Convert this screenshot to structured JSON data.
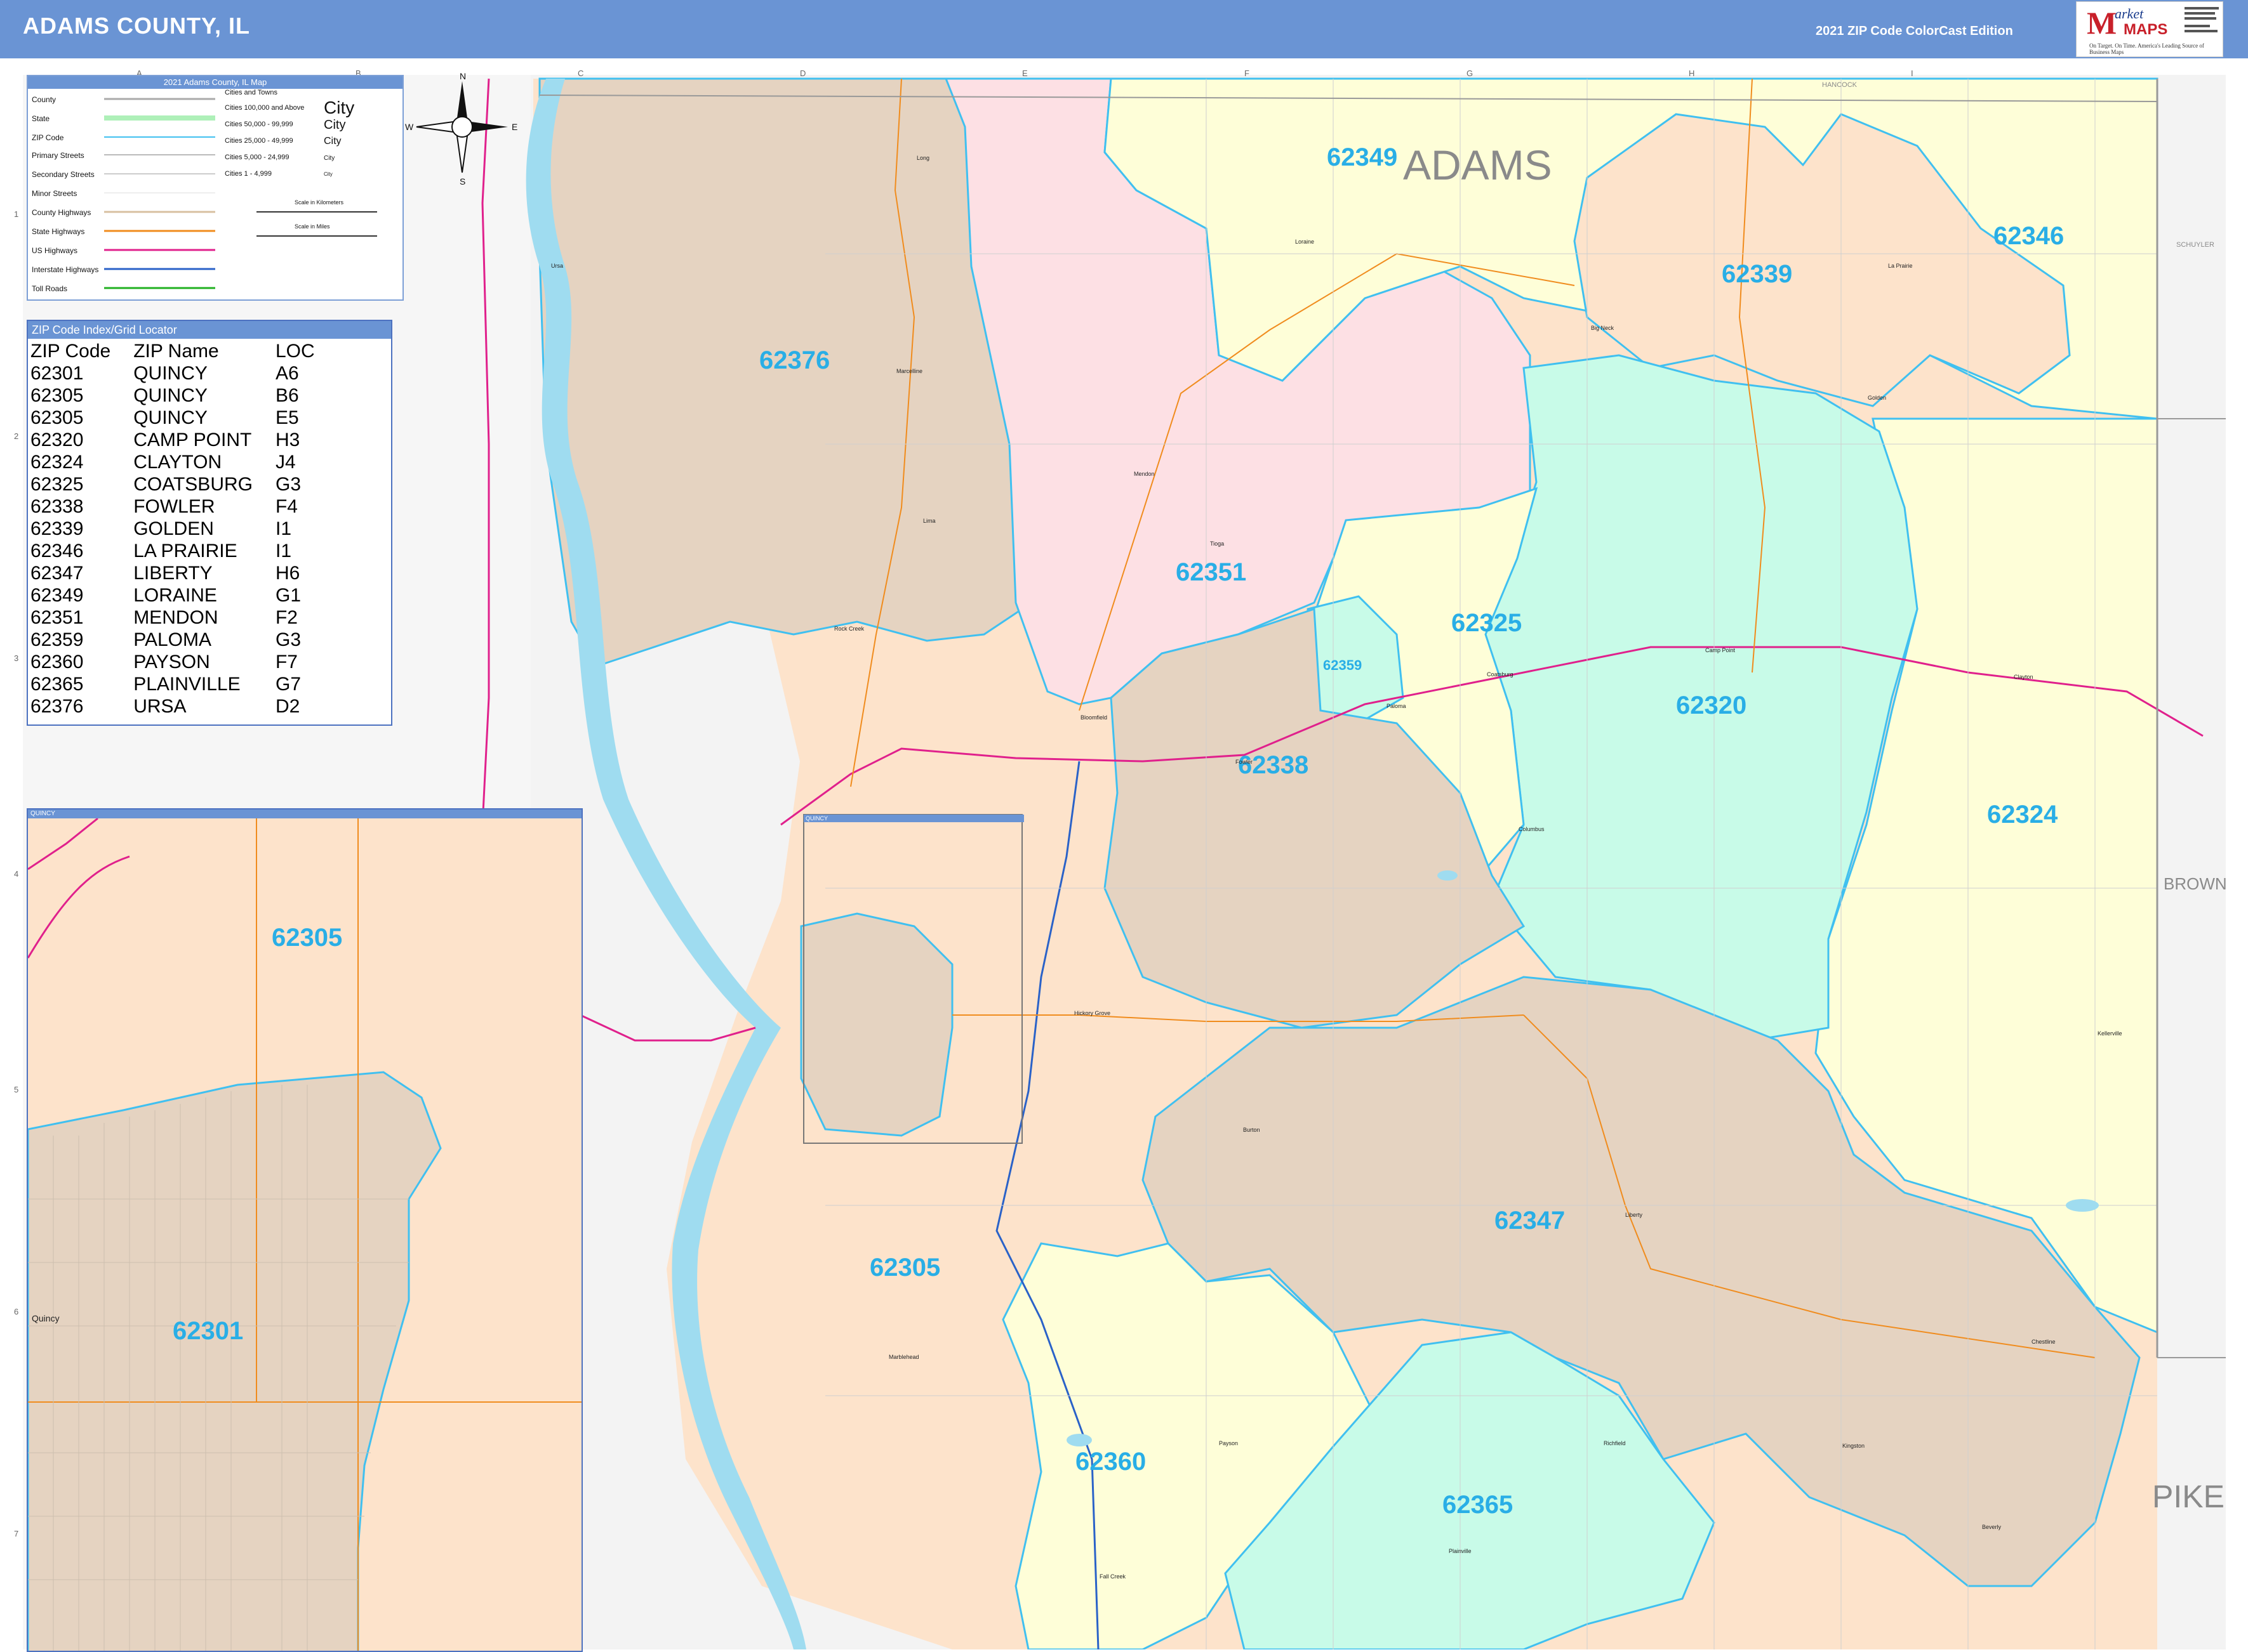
{
  "header": {
    "title": "ADAMS COUNTY, IL",
    "edition": "2021 ZIP Code ColorCast Edition",
    "logo_m": "M",
    "logo_text": "arket",
    "logo_maps": "MAPS",
    "logo_tagline": "On Target. On Time. America's Leading Source of Business Maps"
  },
  "grid": {
    "columns": [
      "A",
      "B",
      "C",
      "D",
      "E",
      "F",
      "G",
      "H",
      "I"
    ],
    "rows": [
      "1",
      "2",
      "3",
      "4",
      "5",
      "6",
      "7"
    ]
  },
  "legend": {
    "title": "2021 Adams County, IL Map",
    "items": [
      "County",
      "State",
      "ZIP Code",
      "Primary Streets",
      "Secondary Streets",
      "Minor Streets",
      "County Highways",
      "State Highways",
      "US Highways",
      "Interstate Highways",
      "Toll Roads"
    ],
    "cities_title": "Cities and Towns",
    "city_classes": [
      "Cities 100,000 and Above",
      "Cities 50,000 - 99,999",
      "Cities 25,000 - 49,999",
      "Cities 5,000 - 24,999",
      "Cities 1 - 4,999"
    ],
    "city_samples": [
      "City",
      "City",
      "City",
      "City",
      "City"
    ],
    "scale_km": "Scale in Kilometers",
    "scale_mi": "Scale in Miles"
  },
  "zip_index": {
    "title": "ZIP Code Index/Grid Locator",
    "headers": [
      "ZIP Code",
      "ZIP Name",
      "LOC"
    ],
    "rows": [
      [
        "62301",
        "QUINCY",
        "A6"
      ],
      [
        "62305",
        "QUINCY",
        "B6"
      ],
      [
        "62305",
        "QUINCY",
        "E5"
      ],
      [
        "62320",
        "CAMP POINT",
        "H3"
      ],
      [
        "62324",
        "CLAYTON",
        "J4"
      ],
      [
        "62325",
        "COATSBURG",
        "G3"
      ],
      [
        "62338",
        "FOWLER",
        "F4"
      ],
      [
        "62339",
        "GOLDEN",
        "I1"
      ],
      [
        "62346",
        "LA PRAIRIE",
        "I1"
      ],
      [
        "62347",
        "LIBERTY",
        "H6"
      ],
      [
        "62349",
        "LORAINE",
        "G1"
      ],
      [
        "62351",
        "MENDON",
        "F2"
      ],
      [
        "62359",
        "PALOMA",
        "G3"
      ],
      [
        "62360",
        "PAYSON",
        "F7"
      ],
      [
        "62365",
        "PLAINVILLE",
        "G7"
      ],
      [
        "62376",
        "URSA",
        "D2"
      ]
    ]
  },
  "zip_labels": {
    "z62349": "62349",
    "z62346": "62346",
    "z62339": "62339",
    "z62376": "62376",
    "z62351": "62351",
    "z62325": "62325",
    "z62359": "62359",
    "z62320": "62320",
    "z62338": "62338",
    "z62324": "62324",
    "z62347": "62347",
    "z62305": "62305",
    "z62360": "62360",
    "z62365": "62365",
    "inset_62305": "62305",
    "inset_62301": "62301"
  },
  "county_labels": {
    "adams": "ADAMS",
    "brown": "BROWN",
    "pike": "PIKE",
    "schuyler": "SCHUYLER",
    "hancock": "HANCOCK"
  },
  "towns": {
    "ursa": "Ursa",
    "mendon": "Mendon",
    "loraine": "Loraine",
    "golden": "Golden",
    "laprairie": "La Prairie",
    "campPoint": "Camp Point",
    "clayton": "Clayton",
    "coatsburg": "Coatsburg",
    "paloma": "Paloma",
    "columbus": "Columbus",
    "fowler": "Fowler",
    "hickoryGrove": "Hickory Grove",
    "liberty": "Liberty",
    "marblehead": "Marblehead",
    "payson": "Payson",
    "plainville": "Plainville",
    "fallCreek": "Fall Creek",
    "kingston": "Kingston",
    "richfield": "Richfield",
    "beverly": "Beverly",
    "chestline": "Chestline",
    "kellerville": "Kellerville",
    "bigNeck": "Big Neck",
    "marcelline": "Marcelline",
    "lima": "Lima",
    "rockCreek": "Rock Creek",
    "bloomfield": "Bloomfield",
    "long": "Long",
    "tioga": "Tioga",
    "burton": "Burton",
    "quincyInset": "Quincy"
  },
  "inset": {
    "title": "QUINCY"
  },
  "quincy_box": {
    "title": "QUINCY"
  },
  "colors": {
    "header": "#6a94d4",
    "zip_label": "#29aee6",
    "peach": "#fde3cb",
    "tan": "#e5d3c1",
    "pink": "#fde0e4",
    "yellow": "#fefed8",
    "mint": "#c8fbe8",
    "river": "#9fdcf0",
    "zip_border": "#40c0f0"
  },
  "compass": [
    "N",
    "S",
    "E",
    "W"
  ]
}
